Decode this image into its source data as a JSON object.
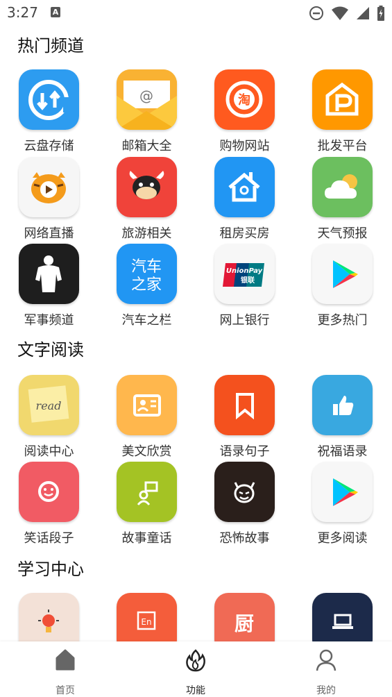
{
  "status_bar": {
    "time": "3:27",
    "notif_letter": "A"
  },
  "sections": [
    {
      "title": "热门频道",
      "items": [
        {
          "label": "云盘存储",
          "icon": "cloud-sync-icon",
          "bg": "#2d9cf0"
        },
        {
          "label": "邮箱大全",
          "icon": "mail-envelope-icon",
          "bg": "#f9b233"
        },
        {
          "label": "购物网站",
          "icon": "taobao-icon",
          "bg": "#ff5a1f"
        },
        {
          "label": "批发平台",
          "icon": "house-p-icon",
          "bg": "#ff9800"
        },
        {
          "label": "网络直播",
          "icon": "tiger-play-icon",
          "bg": "#f6f6f6"
        },
        {
          "label": "旅游相关",
          "icon": "cow-icon",
          "bg": "#f0433a"
        },
        {
          "label": "租房买房",
          "icon": "home-location-icon",
          "bg": "#2196f3"
        },
        {
          "label": "天气预报",
          "icon": "weather-cloud-icon",
          "bg": "#6cbf5f"
        },
        {
          "label": "军事频道",
          "icon": "soldier-icon",
          "bg": "#1e1e1e"
        },
        {
          "label": "汽车之栏",
          "icon": "car-home-icon",
          "bg": "#2196f3",
          "icon_text": "汽车之家"
        },
        {
          "label": "网上银行",
          "icon": "unionpay-icon",
          "bg": "#f7f7f7"
        },
        {
          "label": "更多热门",
          "icon": "play-store-icon",
          "bg": "#f7f7f7"
        }
      ]
    },
    {
      "title": "文字阅读",
      "items": [
        {
          "label": "阅读中心",
          "icon": "read-note-icon",
          "bg": "#f1d86e",
          "icon_text": "read"
        },
        {
          "label": "美文欣赏",
          "icon": "contact-card-icon",
          "bg": "#ffb74d"
        },
        {
          "label": "语录句子",
          "icon": "bookmark-icon",
          "bg": "#f4511e"
        },
        {
          "label": "祝福语录",
          "icon": "thumbs-up-icon",
          "bg": "#39a8e0"
        },
        {
          "label": "笑话段子",
          "icon": "smile-icon",
          "bg": "#f15b64"
        },
        {
          "label": "故事童话",
          "icon": "storyteller-icon",
          "bg": "#a4c324"
        },
        {
          "label": "恐怖故事",
          "icon": "devil-icon",
          "bg": "#2a1f1b"
        },
        {
          "label": "更多阅读",
          "icon": "play-store-icon",
          "bg": "#f7f7f7"
        }
      ]
    },
    {
      "title": "学习中心",
      "items": [
        {
          "label": "",
          "icon": "lightbulb-icon",
          "bg": "#f3e1d7"
        },
        {
          "label": "",
          "icon": "english-book-icon",
          "bg": "#f45d3b"
        },
        {
          "label": "",
          "icon": "kitchen-char-icon",
          "bg": "#f06a55",
          "icon_text": "厨"
        },
        {
          "label": "",
          "icon": "laptop-icon",
          "bg": "#1c2a4a"
        }
      ]
    }
  ],
  "bottom_nav": [
    {
      "label": "首页",
      "icon": "home-icon"
    },
    {
      "label": "功能",
      "icon": "flame-icon"
    },
    {
      "label": "我的",
      "icon": "person-icon"
    }
  ]
}
